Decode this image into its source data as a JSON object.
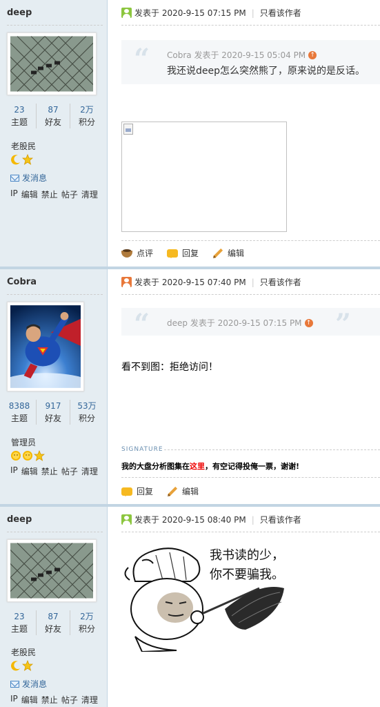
{
  "posts": [
    {
      "username": "deep",
      "stats": [
        {
          "value": "23",
          "label": "主题"
        },
        {
          "value": "87",
          "label": "好友"
        },
        {
          "value": "2万",
          "label": "积分"
        }
      ],
      "rank": "老股民",
      "send_message": "发消息",
      "admin_links": [
        "IP",
        "编辑",
        "禁止",
        "帖子",
        "清理"
      ],
      "meta": {
        "posted": "发表于 2020-9-15 07:15 PM",
        "only_author": "只看该作者"
      },
      "quote": {
        "author_line": "Cobra 发表于 2020-9-15 05:04 PM",
        "text": "我还说deep怎么突然熊了，原来说的是反话。"
      },
      "actions": [
        "点评",
        "回复",
        "编辑"
      ]
    },
    {
      "username": "Cobra",
      "stats": [
        {
          "value": "8388",
          "label": "主题"
        },
        {
          "value": "917",
          "label": "好友"
        },
        {
          "value": "53万",
          "label": "积分"
        }
      ],
      "rank": "管理员",
      "admin_links": [
        "IP",
        "编辑",
        "禁止",
        "帖子",
        "清理"
      ],
      "meta": {
        "posted": "发表于 2020-9-15 07:40 PM",
        "only_author": "只看该作者"
      },
      "quote": {
        "author_line": "deep 发表于 2020-9-15 07:15 PM"
      },
      "content": "看不到图：拒绝访问！",
      "signature_label": "SIGNATURE",
      "signature": {
        "before": "我的大盘分析图集在",
        "link": "这里",
        "after": "，有空记得投俺一票，谢谢!"
      },
      "actions": [
        "回复",
        "编辑"
      ]
    },
    {
      "username": "deep",
      "stats": [
        {
          "value": "23",
          "label": "主题"
        },
        {
          "value": "87",
          "label": "好友"
        },
        {
          "value": "2万",
          "label": "积分"
        }
      ],
      "rank": "老股民",
      "send_message": "发消息",
      "admin_links": [
        "IP",
        "编辑",
        "禁止",
        "帖子",
        "清理"
      ],
      "meta": {
        "posted": "发表于 2020-9-15 08:40 PM",
        "only_author": "只看该作者"
      },
      "meme_text": [
        "我书读的少，",
        "你不要骗我。"
      ]
    }
  ],
  "colors": {
    "sidebar_bg": "#e5edf2",
    "link_blue": "#369",
    "separator": "#c2d5e3",
    "signature_link": "#e00"
  }
}
